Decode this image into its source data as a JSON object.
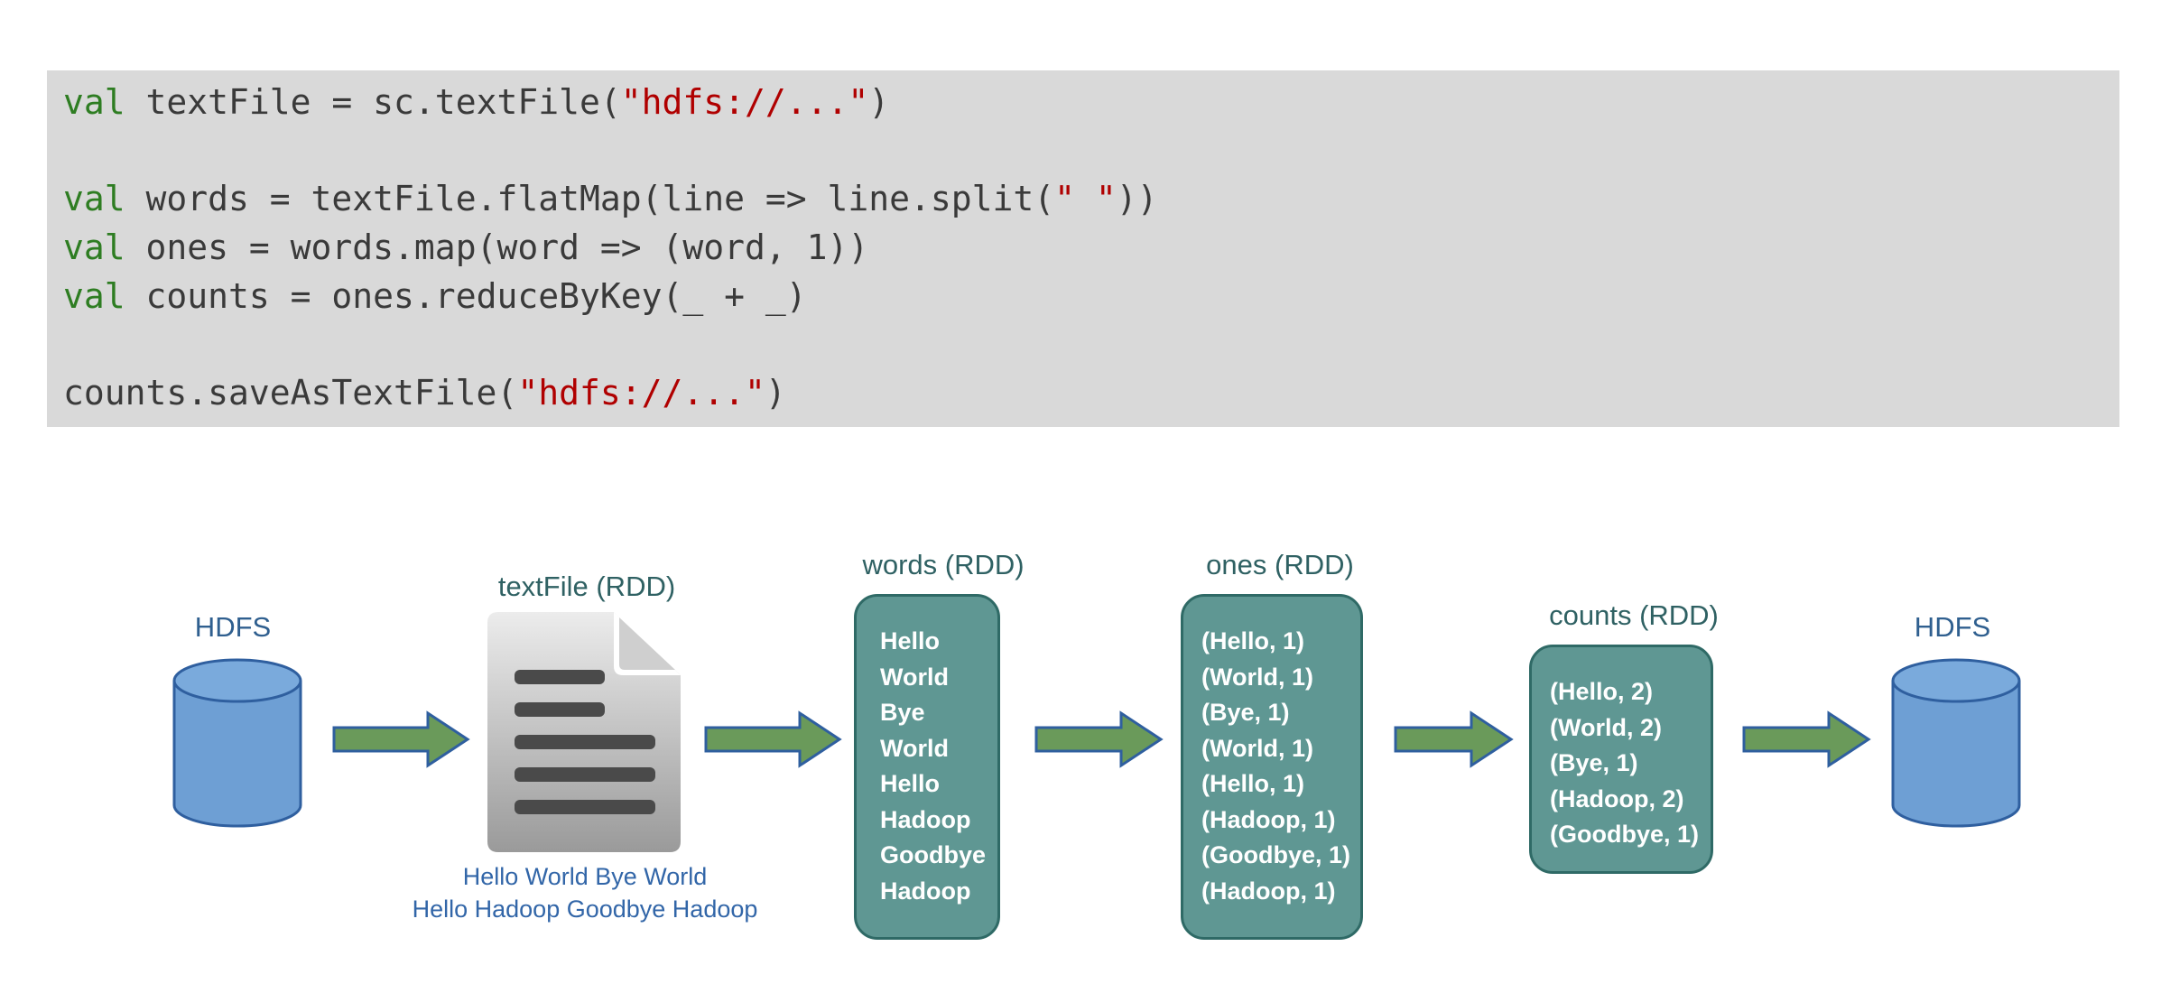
{
  "code": {
    "lines": [
      [
        {
          "t": "kw",
          "v": "val"
        },
        {
          "t": "plain",
          "v": " textFile = sc.textFile("
        },
        {
          "t": "str",
          "v": "\"hdfs://...\""
        },
        {
          "t": "plain",
          "v": ")"
        }
      ],
      [
        {
          "t": "kw",
          "v": "val"
        },
        {
          "t": "plain",
          "v": " words = textFile.flatMap(line => line.split("
        },
        {
          "t": "str",
          "v": "\" \""
        },
        {
          "t": "plain",
          "v": "))"
        }
      ],
      [
        {
          "t": "kw",
          "v": "val"
        },
        {
          "t": "plain",
          "v": " ones = words.map(word => (word, 1))"
        }
      ],
      [
        {
          "t": "kw",
          "v": "val"
        },
        {
          "t": "plain",
          "v": " counts = ones.reduceByKey(_ + _)"
        }
      ],
      [
        {
          "t": "plain",
          "v": "counts.saveAsTextFile("
        },
        {
          "t": "str",
          "v": "\"hdfs://...\""
        },
        {
          "t": "plain",
          "v": ")"
        }
      ]
    ]
  },
  "diagram": {
    "hdfs_in_label": "HDFS",
    "textfile_label": "textFile (RDD)",
    "textfile_caption": [
      "Hello World Bye World",
      "Hello Hadoop Goodbye Hadoop"
    ],
    "words_label": "words (RDD)",
    "words_items": [
      "Hello",
      "World",
      "Bye",
      "World",
      "Hello",
      "Hadoop",
      "Goodbye",
      "Hadoop"
    ],
    "ones_label": "ones (RDD)",
    "ones_items": [
      "(Hello, 1)",
      "(World, 1)",
      "(Bye, 1)",
      "(World, 1)",
      "(Hello, 1)",
      "(Hadoop, 1)",
      "(Goodbye, 1)",
      "(Hadoop, 1)"
    ],
    "counts_label": "counts (RDD)",
    "counts_items": [
      "(Hello, 2)",
      "(World, 2)",
      "(Bye, 1)",
      "(Hadoop, 2)",
      "(Goodbye, 1)"
    ],
    "hdfs_out_label": "HDFS"
  },
  "colors": {
    "keyword": "#2e7d22",
    "string": "#b00000",
    "rdd_fill": "#5f9793",
    "arrow_fill": "#6a9a5a",
    "arrow_stroke": "#2f5f9f",
    "cylinder_fill": "#6e9fd4"
  }
}
